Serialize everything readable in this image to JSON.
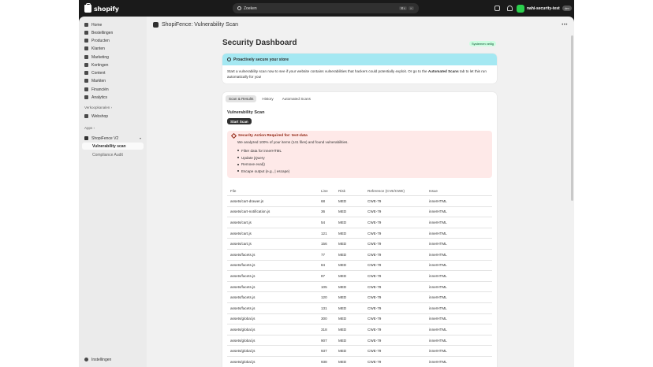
{
  "topbar": {
    "logo_text": "shopify",
    "search_placeholder": "Zoeken",
    "search_kbd_1": "⌘K",
    "search_kbd_2": "K",
    "store_name": "nahi-security-test",
    "store_pill": "dev"
  },
  "sidebar": {
    "items": [
      {
        "label": "Home",
        "icon": "home-icon"
      },
      {
        "label": "Bestellingen",
        "icon": "orders-icon"
      },
      {
        "label": "Producten",
        "icon": "tag-icon"
      },
      {
        "label": "Klanten",
        "icon": "person-icon"
      },
      {
        "label": "Marketing",
        "icon": "target-icon"
      },
      {
        "label": "Kortingen",
        "icon": "discount-icon"
      },
      {
        "label": "Content",
        "icon": "content-icon"
      },
      {
        "label": "Markten",
        "icon": "globe-icon"
      },
      {
        "label": "Financiën",
        "icon": "bank-icon"
      },
      {
        "label": "Analytics",
        "icon": "chart-icon"
      }
    ],
    "sales_channels_heading": "Verkoopkanalen",
    "webshop_label": "Webshop",
    "apps_heading": "Apps",
    "app_name": "ShopiFence V2",
    "app_sub_items": [
      "Vulnerability scan",
      "Compliance Audit"
    ],
    "settings_label": "Instellingen"
  },
  "header": {
    "app_title": "ShopiFence: Vulnerability Scan",
    "more_label": "•••"
  },
  "page": {
    "title": "Security Dashboard",
    "badge": "Systemen veilig"
  },
  "banner": {
    "title": "Proactively secure your store",
    "body_prefix": "Start a vulnerability scan now to see if your website contains vulnerabilities that hackers could potentially exploit. Or go to the ",
    "body_bold": "Automated Scans",
    "body_suffix": " tab to let this run automatically for you!"
  },
  "tabs": [
    "Scan & Results",
    "History",
    "Automated Scans"
  ],
  "scan": {
    "section_title": "Vulnerability Scan",
    "start_button": "Start Scan"
  },
  "alert": {
    "title": "Security Action Required for: test-data",
    "description": "We analyzed 100% of your items (141 files) and found vulnerabilities.",
    "actions": [
      "Filter data for innerHTML",
      "Update jQuery",
      "Remove eval()",
      "Escape output (e.g., | escape)"
    ]
  },
  "table": {
    "headers": [
      "File",
      "Line",
      "Risk",
      "Reference (CVE/CWE)",
      "Issue"
    ],
    "rows": [
      [
        "assets/cart-drawer.js",
        "68",
        "MED",
        "CWE-79",
        "innerHTML"
      ],
      [
        "assets/cart-notification.js",
        "36",
        "MED",
        "CWE-79",
        "innerHTML"
      ],
      [
        "assets/cart.js",
        "54",
        "MED",
        "CWE-79",
        "innerHTML"
      ],
      [
        "assets/cart.js",
        "121",
        "MED",
        "CWE-79",
        "innerHTML"
      ],
      [
        "assets/cart.js",
        "156",
        "MED",
        "CWE-79",
        "innerHTML"
      ],
      [
        "assets/facets.js",
        "77",
        "MED",
        "CWE-79",
        "innerHTML"
      ],
      [
        "assets/facets.js",
        "84",
        "MED",
        "CWE-79",
        "innerHTML"
      ],
      [
        "assets/facets.js",
        "87",
        "MED",
        "CWE-79",
        "innerHTML"
      ],
      [
        "assets/facets.js",
        "105",
        "MED",
        "CWE-79",
        "innerHTML"
      ],
      [
        "assets/facets.js",
        "120",
        "MED",
        "CWE-79",
        "innerHTML"
      ],
      [
        "assets/facets.js",
        "131",
        "MED",
        "CWE-79",
        "innerHTML"
      ],
      [
        "assets/global.js",
        "300",
        "MED",
        "CWE-79",
        "innerHTML"
      ],
      [
        "assets/global.js",
        "318",
        "MED",
        "CWE-79",
        "innerHTML"
      ],
      [
        "assets/global.js",
        "907",
        "MED",
        "CWE-79",
        "innerHTML"
      ],
      [
        "assets/global.js",
        "937",
        "MED",
        "CWE-79",
        "innerHTML"
      ],
      [
        "assets/global.js",
        "938",
        "MED",
        "CWE-79",
        "innerHTML"
      ]
    ]
  }
}
